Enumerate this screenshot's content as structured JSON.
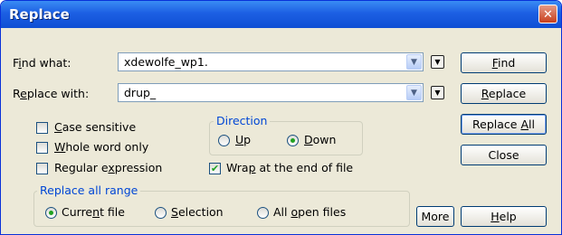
{
  "window": {
    "title": "Replace"
  },
  "find": {
    "label_pre": "F",
    "label_u": "i",
    "label_post": "nd what:",
    "value": "xdewolfe_wp1."
  },
  "replace": {
    "label_pre": "R",
    "label_u": "e",
    "label_post": "place with:",
    "value": "drup_"
  },
  "options": {
    "case_sensitive": {
      "pre": "",
      "u": "C",
      "post": "ase sensitive",
      "checked": false
    },
    "whole_word": {
      "pre": "",
      "u": "W",
      "post": "hole word only",
      "checked": false
    },
    "regex": {
      "pre": "Regular e",
      "u": "x",
      "post": "pression",
      "checked": false
    },
    "wrap": {
      "pre": "Wra",
      "u": "p",
      "post": " at the end of file",
      "checked": true
    }
  },
  "direction": {
    "label": "Direction",
    "up": {
      "pre": "",
      "u": "U",
      "post": "p",
      "selected": false
    },
    "down": {
      "pre": "",
      "u": "D",
      "post": "own",
      "selected": true
    }
  },
  "range": {
    "label": "Replace all range",
    "current": {
      "pre": "Curre",
      "u": "n",
      "post": "t file",
      "selected": true
    },
    "selection": {
      "pre": "",
      "u": "S",
      "post": "election",
      "selected": false
    },
    "all": {
      "pre": "All ",
      "u": "o",
      "post": "pen files",
      "selected": false
    }
  },
  "buttons": {
    "find": {
      "pre": "",
      "u": "F",
      "post": "ind"
    },
    "replace": {
      "pre": "",
      "u": "R",
      "post": "eplace"
    },
    "replace_all": {
      "pre": "Replace ",
      "u": "A",
      "post": "ll"
    },
    "close": {
      "pre": "Close",
      "u": "",
      "post": ""
    },
    "more": {
      "pre": "More",
      "u": "",
      "post": ""
    },
    "help": {
      "pre": "",
      "u": "H",
      "post": "elp"
    }
  },
  "icons": {
    "close": "close-icon",
    "dropdown": "chevron-down-icon",
    "history": "triangle-down-icon"
  }
}
